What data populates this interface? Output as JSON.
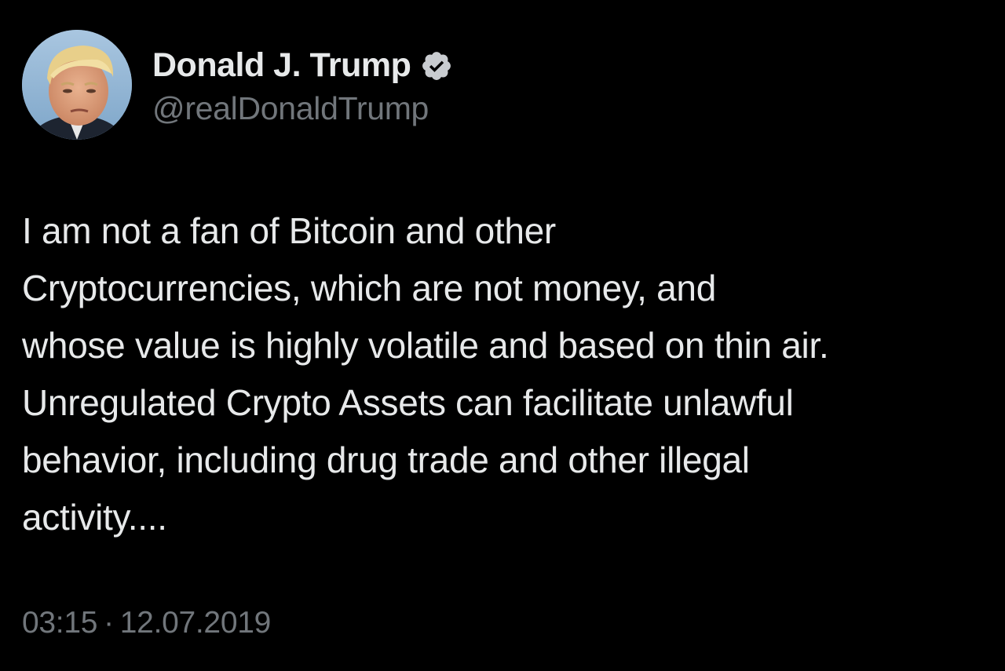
{
  "tweet": {
    "author": {
      "display_name": "Donald J. Trump",
      "handle": "@realDonaldTrump",
      "verified": true,
      "verified_color": "#1d9bf0",
      "avatar_icon": "profile-photo"
    },
    "text_lines": [
      "I am not a fan of Bitcoin and other",
      "Cryptocurrencies, which are not money, and",
      "whose value is highly volatile and based on thin air.",
      "Unregulated Crypto Assets can facilitate unlawful",
      "behavior, including drug trade and other illegal",
      "activity...."
    ],
    "time": "03:15",
    "separator": "·",
    "date": "12.07.2019"
  },
  "colors": {
    "background": "#000000",
    "primary_text": "#e7e9ea",
    "secondary_text": "#71767b"
  }
}
